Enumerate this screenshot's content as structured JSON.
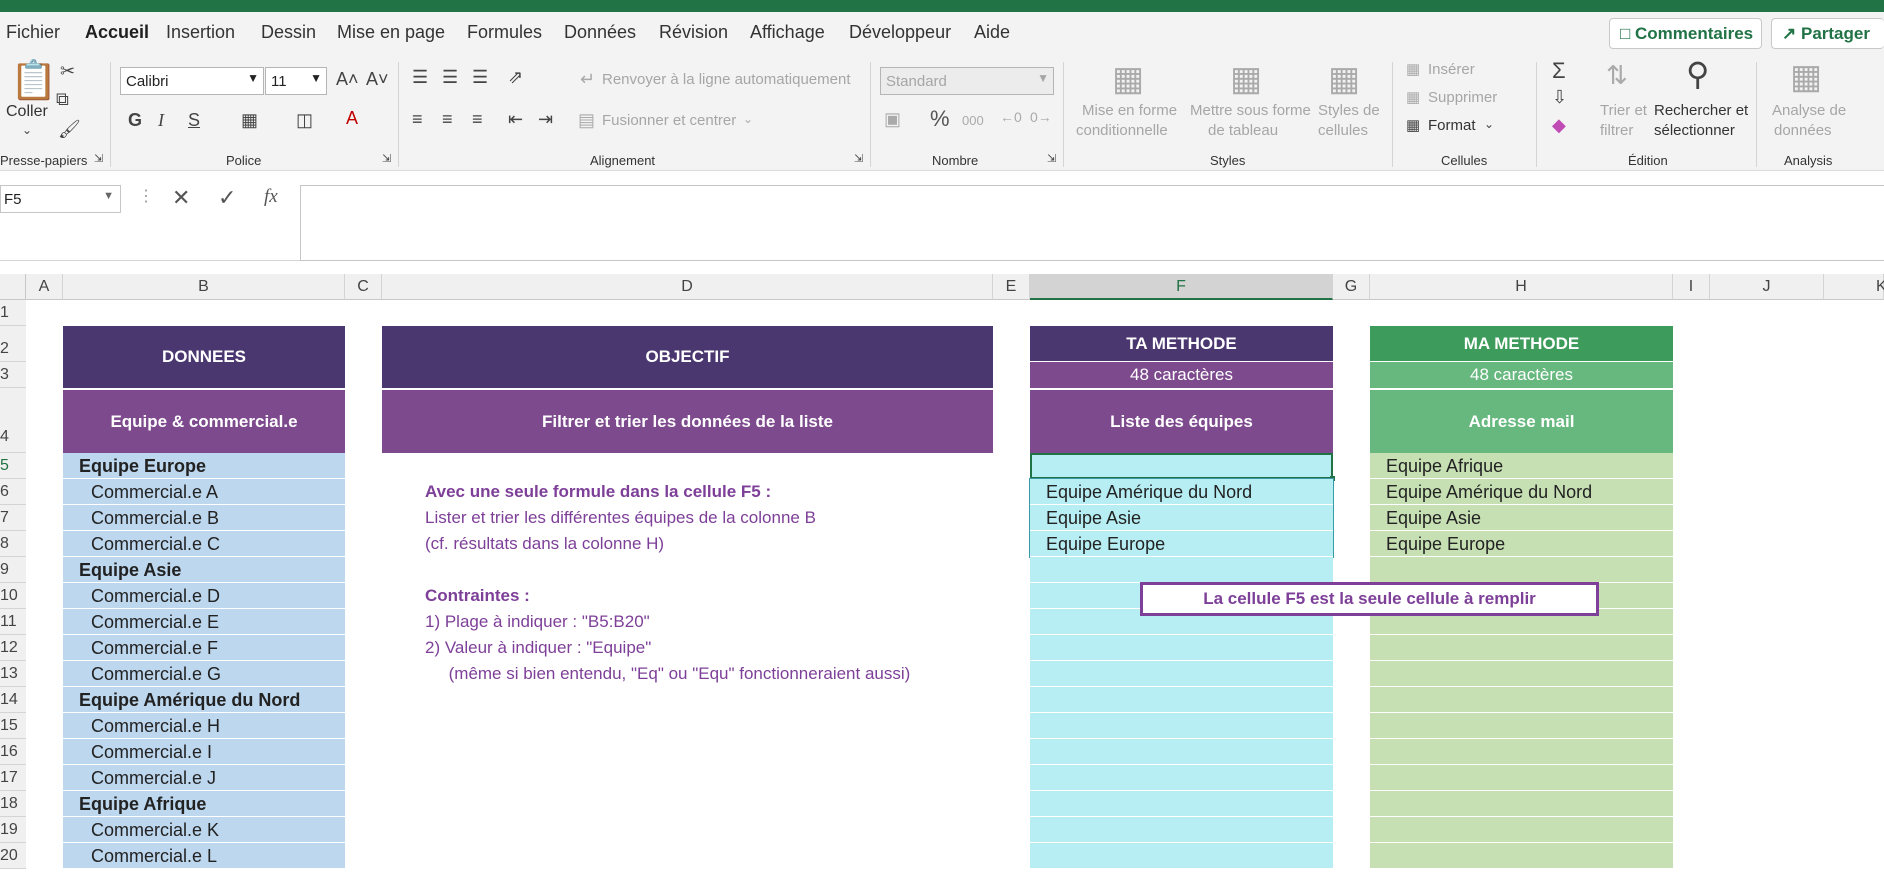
{
  "colors": {
    "accent": "#217346",
    "purple_dark": "#4b376f",
    "purple_mid": "#7d4a8e",
    "green_dark": "#3d9b5b",
    "green_mid": "#66b87e",
    "blue_light": "#bdd7ee",
    "cyan_light": "#b7eef3",
    "green_light": "#c6e0b4"
  },
  "menu": {
    "items": [
      "Fichier",
      "Accueil",
      "Insertion",
      "Dessin",
      "Mise en page",
      "Formules",
      "Données",
      "Révision",
      "Affichage",
      "Développeur",
      "Aide"
    ],
    "comments_label": "Commentaires",
    "share_label": "Partager"
  },
  "ribbon": {
    "paste_label": "Coller",
    "clipboard_group": "Presse-papiers",
    "font_name": "Calibri",
    "font_size": "11",
    "font_group": "Police",
    "wrap_label": "Renvoyer à la ligne automatiquement",
    "merge_label": "Fusionner et centrer",
    "alignment_group": "Alignement",
    "number_format": "Standard",
    "percent_symbol": "%",
    "thousands_symbol": "000",
    "number_group": "Nombre",
    "cond_format_1": "Mise en forme",
    "cond_format_2": "conditionnelle",
    "table_format_1": "Mettre sous forme",
    "table_format_2": "de tableau",
    "cell_styles_1": "Styles de",
    "cell_styles_2": "cellules",
    "styles_group": "Styles",
    "insert_label": "Insérer",
    "delete_label": "Supprimer",
    "format_label": "Format",
    "cells_group": "Cellules",
    "sort_1": "Trier et",
    "sort_2": "filtrer",
    "find_1": "Rechercher et",
    "find_2": "sélectionner",
    "editing_group": "Édition",
    "analysis_1": "Analyse de",
    "analysis_2": "données",
    "analysis_group": "Analysis"
  },
  "formula_bar": {
    "name_box": "F5",
    "fx": "fx",
    "formula": ""
  },
  "columns": [
    "A",
    "B",
    "C",
    "D",
    "E",
    "F",
    "G",
    "H",
    "I",
    "J",
    "K"
  ],
  "rows": [
    "1",
    "2",
    "3",
    "4",
    "5",
    "6",
    "7",
    "8",
    "9",
    "10",
    "11",
    "12",
    "13",
    "14",
    "15",
    "16",
    "17",
    "18",
    "19",
    "20"
  ],
  "sheet": {
    "donnees_title": "DONNEES",
    "donnees_sub": "Equipe & commercial.e",
    "objectif_title": "OBJECTIF",
    "objectif_sub": "Filtrer et trier les données de la liste",
    "ta_methode_title": "TA METHODE",
    "ta_methode_chars": "48 caractères",
    "ta_methode_sub": "Liste des équipes",
    "ma_methode_title": "MA METHODE",
    "ma_methode_chars": "48 caractères",
    "ma_methode_sub": "Adresse mail",
    "list_b": [
      {
        "text": "Equipe Europe",
        "bold": true
      },
      {
        "text": "Commercial.e A",
        "bold": false
      },
      {
        "text": "Commercial.e B",
        "bold": false
      },
      {
        "text": "Commercial.e C",
        "bold": false
      },
      {
        "text": "Equipe Asie",
        "bold": true
      },
      {
        "text": "Commercial.e D",
        "bold": false
      },
      {
        "text": "Commercial.e E",
        "bold": false
      },
      {
        "text": "Commercial.e F",
        "bold": false
      },
      {
        "text": "Commercial.e G",
        "bold": false
      },
      {
        "text": "Equipe Amérique du Nord",
        "bold": true
      },
      {
        "text": "Commercial.e H",
        "bold": false
      },
      {
        "text": "Commercial.e I",
        "bold": false
      },
      {
        "text": "Commercial.e J",
        "bold": false
      },
      {
        "text": "Equipe Afrique",
        "bold": true
      },
      {
        "text": "Commercial.e K",
        "bold": false
      },
      {
        "text": "Commercial.e L",
        "bold": false
      }
    ],
    "list_f": [
      "",
      "Equipe Amérique du Nord",
      "Equipe Asie",
      "Equipe Europe"
    ],
    "list_h": [
      "Equipe Afrique",
      "Equipe Amérique du Nord",
      "Equipe Asie",
      "Equipe Europe"
    ],
    "objective_lines": [
      {
        "text": "Avec une seule formule dans la cellule F5 :",
        "bold": true
      },
      {
        "text": "Lister et trier les différentes équipes de la colonne B",
        "bold": false
      },
      {
        "text": "(cf. résultats dans la colonne H)",
        "bold": false
      },
      {
        "text": "",
        "bold": false
      },
      {
        "text": "Contraintes :",
        "bold": true
      },
      {
        "text": "1) Plage à indiquer : \"B5:B20\"",
        "bold": false
      },
      {
        "text": "2) Valeur à indiquer : \"Equipe\"",
        "bold": false
      },
      {
        "text": "     (même si bien entendu, \"Eq\" ou \"Equ\" fonctionneraient aussi)",
        "bold": false
      }
    ],
    "note_box": "La cellule F5 est la seule cellule à remplir"
  }
}
